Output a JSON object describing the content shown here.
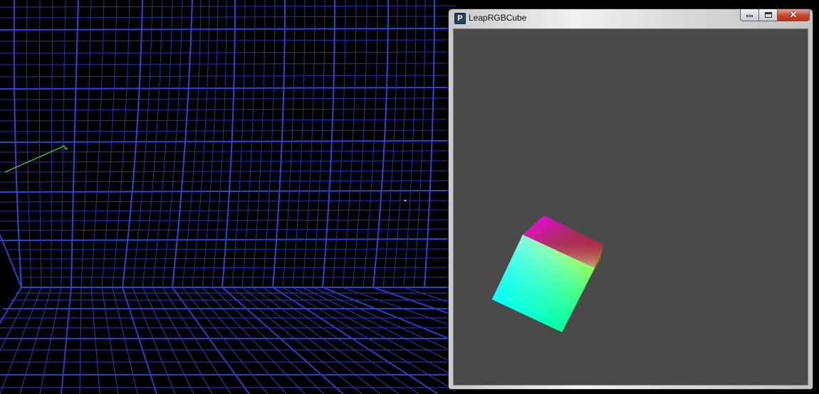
{
  "window": {
    "title": "LeapRGBCube",
    "icon_letter": "P",
    "controls": {
      "minimize": "minimize",
      "maximize": "maximize",
      "close": "✕"
    }
  },
  "colors": {
    "desktop_background": "#000000",
    "grid_lines": "#2f3fc8",
    "hand_trace": "#3ec23e",
    "canvas_background": "#4a4a4a"
  },
  "icons": [
    "processing-app-icon",
    "minimize-icon",
    "maximize-icon",
    "close-icon"
  ]
}
